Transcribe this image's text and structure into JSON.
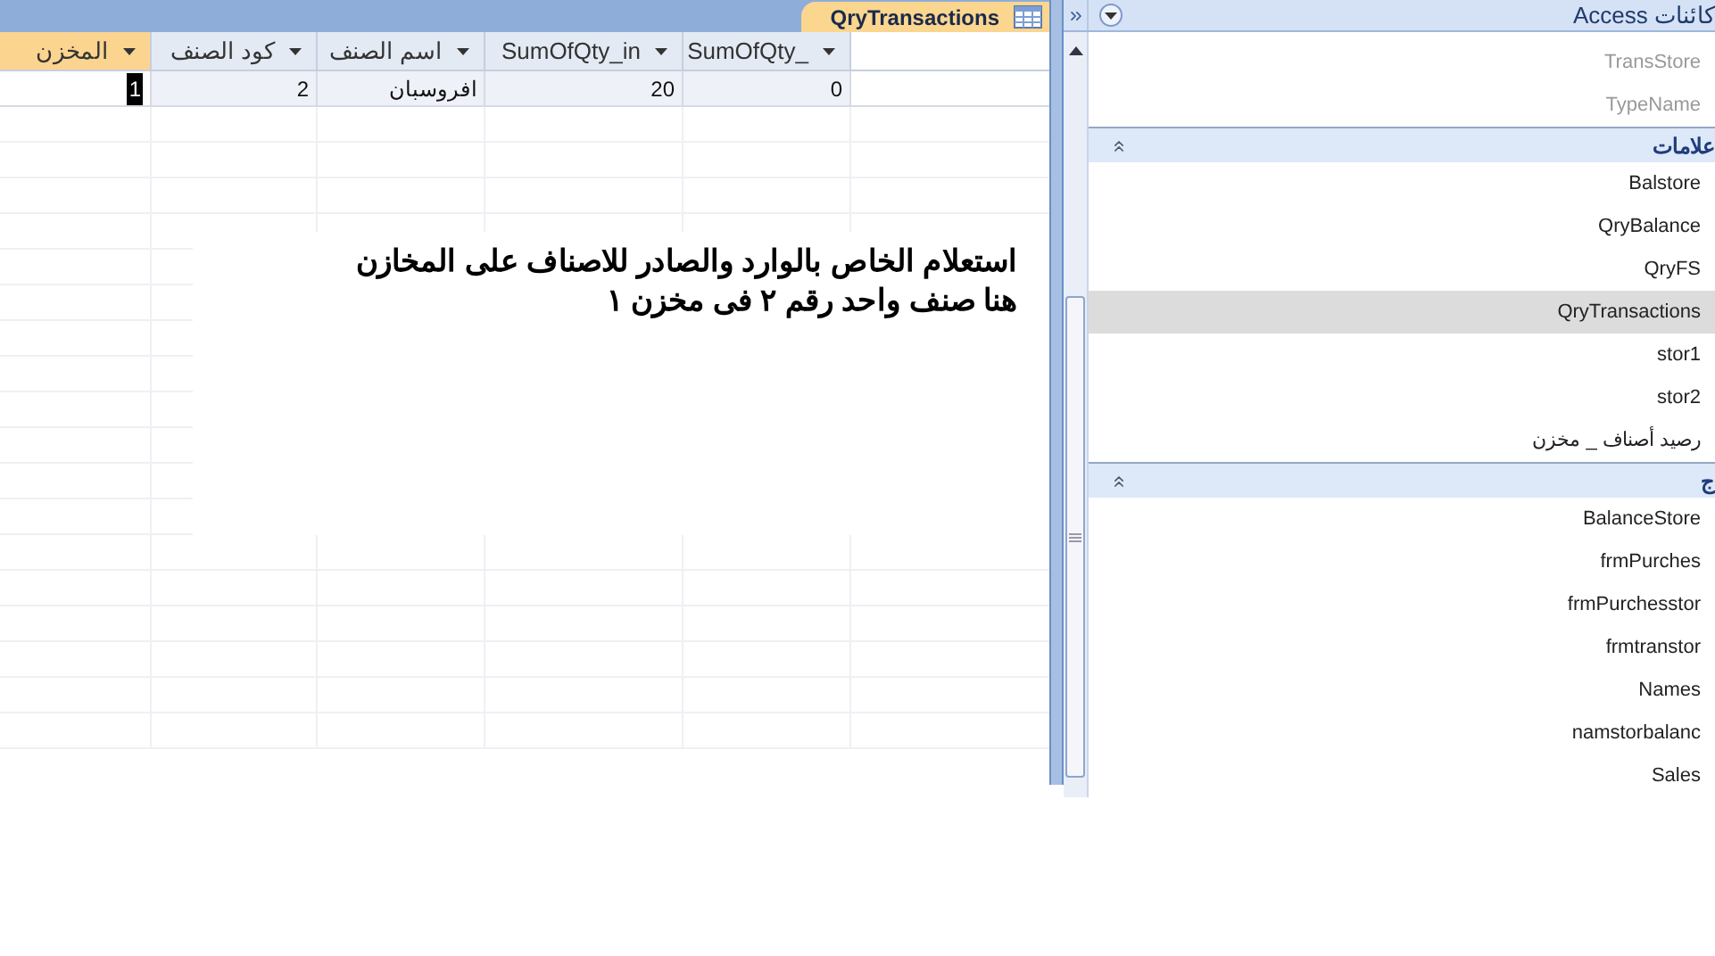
{
  "document_tab": {
    "title": "QryTransactions",
    "selected": true
  },
  "datasheet": {
    "columns": [
      {
        "label": "SumOfQty_",
        "selected": false
      },
      {
        "label": "SumOfQty_in",
        "selected": false
      },
      {
        "label": "اسم الصنف",
        "selected": false
      },
      {
        "label": "كود الصنف",
        "selected": false
      },
      {
        "label": "المخزن",
        "selected": true
      }
    ],
    "rows": [
      {
        "cells": [
          {
            "text": "0",
            "selected": false
          },
          {
            "text": "20",
            "selected": false
          },
          {
            "text": "افروسبان",
            "selected": false
          },
          {
            "text": "2",
            "selected": false
          },
          {
            "text": "1",
            "selected": true
          }
        ]
      }
    ]
  },
  "note": {
    "lines": [
      "استعلام الخاص بالوارد والصادر للاصناف على المخازن",
      "هنا صنف واحد رقم ٢ فى مخزن ١"
    ]
  },
  "navigation_pane": {
    "title": "كائنات Access",
    "groups": [
      {
        "items": [
          {
            "label": "TransStore",
            "selected": false,
            "disabled": true
          },
          {
            "label": "TypeName",
            "selected": false,
            "disabled": true
          }
        ]
      },
      {
        "label": "علامات",
        "expanded": true,
        "items": [
          {
            "label": "Balstore",
            "selected": false,
            "disabled": false
          },
          {
            "label": "QryBalance",
            "selected": false,
            "disabled": false
          },
          {
            "label": "QryFS",
            "selected": false,
            "disabled": false
          },
          {
            "label": "QryTransactions",
            "selected": true,
            "disabled": false
          },
          {
            "label": "stor1",
            "selected": false,
            "disabled": false
          },
          {
            "label": "stor2",
            "selected": false,
            "disabled": false
          },
          {
            "label": "رصيد أصناف _ مخزن",
            "selected": false,
            "disabled": false
          }
        ]
      },
      {
        "label": "ج",
        "expanded": true,
        "items": [
          {
            "label": "BalanceStore",
            "selected": false,
            "disabled": false
          },
          {
            "label": "frmPurches",
            "selected": false,
            "disabled": false
          },
          {
            "label": "frmPurchesstor",
            "selected": false,
            "disabled": false
          },
          {
            "label": "frmtranstor",
            "selected": false,
            "disabled": false
          },
          {
            "label": "Names",
            "selected": false,
            "disabled": false
          },
          {
            "label": "namstorbalanc",
            "selected": false,
            "disabled": false
          },
          {
            "label": "Sales",
            "selected": false,
            "disabled": false
          }
        ]
      }
    ]
  }
}
